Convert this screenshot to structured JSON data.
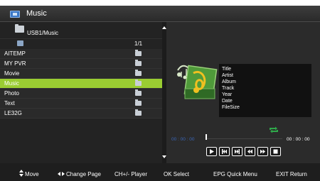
{
  "window": {
    "title": "Music"
  },
  "browser": {
    "path": "USB1/Music",
    "page": "1/1",
    "items": [
      {
        "label": "AITEMP",
        "selected": false
      },
      {
        "label": "MY PVR",
        "selected": false
      },
      {
        "label": "Movie",
        "selected": false
      },
      {
        "label": "Music",
        "selected": true
      },
      {
        "label": "Photo",
        "selected": false
      },
      {
        "label": "Text",
        "selected": false
      },
      {
        "label": "LE32G",
        "selected": false
      }
    ]
  },
  "info": {
    "title": "Title",
    "artist": "Artist",
    "album": "Album",
    "track": "Track",
    "year": "Year",
    "date": "Date",
    "filesize": "FileSize"
  },
  "player": {
    "elapsed": "00 : 00 : 00",
    "total": "00 : 00 : 00",
    "controls": [
      "play",
      "previous",
      "next",
      "rewind",
      "fast-forward",
      "stop"
    ]
  },
  "help": {
    "move": "Move",
    "change_page": "Change Page",
    "player": "CH+/-  Player",
    "select": "OK  Select",
    "quick_menu": "EPG Quick Menu",
    "return": "EXIT  Return"
  },
  "colors": {
    "selection": "#9acd32",
    "time_elapsed": "#3a66b8",
    "repeat": "#2fa84a"
  }
}
